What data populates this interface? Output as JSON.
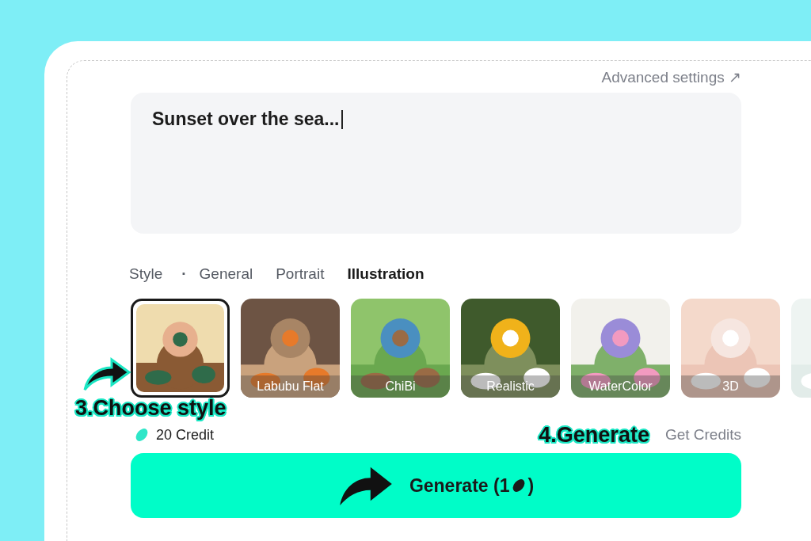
{
  "advanced_settings": {
    "label": "Advanced settings",
    "arrow": "↗"
  },
  "prompt": {
    "value": "Sunset over the sea..."
  },
  "style_tabs": {
    "label": "Style",
    "separator": "·",
    "tabs": [
      {
        "label": "General",
        "selected": false
      },
      {
        "label": "Portrait",
        "selected": false
      },
      {
        "label": "Illustration",
        "selected": true
      }
    ]
  },
  "styles": [
    {
      "selected": true
    },
    {
      "label": "Labubu Flat",
      "selected": false
    },
    {
      "label": "ChiBi",
      "selected": false
    },
    {
      "label": "Realistic",
      "selected": false
    },
    {
      "label": "WaterColor",
      "selected": false
    },
    {
      "label": "3D",
      "selected": false
    },
    {
      "selected": false
    }
  ],
  "annotations": [
    {
      "text": "3.Choose  style"
    },
    {
      "text": "4.Generate"
    }
  ],
  "credits": {
    "balance": "20 Credit",
    "get_credits": "Get Credits"
  },
  "generate_button": {
    "label": "Generate (1",
    "label_end": ")"
  }
}
